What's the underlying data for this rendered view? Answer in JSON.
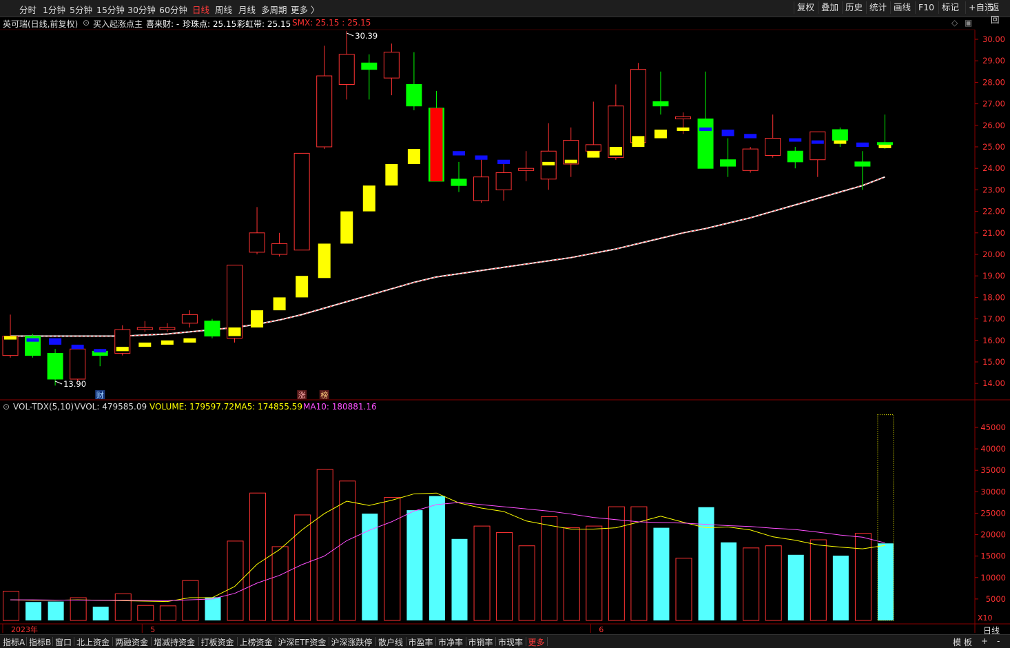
{
  "toolbar": {
    "periods": [
      "分时",
      "1分钟",
      "5分钟",
      "15分钟",
      "30分钟",
      "60分钟",
      "日线",
      "周线",
      "月线",
      "多周期",
      "更多 〉"
    ],
    "active_period": "日线",
    "right_buttons": [
      "复权",
      "叠加",
      "历史",
      "统计",
      "画线",
      "F10",
      "标记",
      "+自选",
      "返回"
    ]
  },
  "info": {
    "stock": "英可瑞(日线,前复权)",
    "indicator": "买入起涨点主",
    "xilaicai": "喜来财: -",
    "zhenzhu": "珍珠点: 25.15",
    "caihong": "彩虹带: 25.15",
    "smx": "SMX: 25.15 : 25.15"
  },
  "vol_info": {
    "name": "VOL-TDX(5,10)",
    "vvol": "VVOL: 479585.09",
    "volume": "VOLUME: 179597.72",
    "ma5": "MA5: 174855.59",
    "ma10": "MA10: 180881.16"
  },
  "bottom_tabs": [
    "指标A",
    "指标B",
    "窗口",
    "北上资金",
    "两融资金",
    "增减持资金",
    "打板资金",
    "上榜资金",
    "沪深ETF资金",
    "沪深涨跌停",
    "散户线",
    "市盈率",
    "市净率",
    "市销率",
    "市现率",
    "更多"
  ],
  "bottom_right": [
    "模 板",
    "+",
    "-"
  ],
  "period_label": "日线",
  "x10_label": "X10",
  "colors": {
    "up": "#ff3232",
    "down": "#54ffff",
    "ma5": "#ffff00",
    "ma10": "#ff50ff",
    "signal_yellow": "#ffff00",
    "signal_blue": "#1010ff",
    "signal_green": "#00ff00",
    "signal_red": "#ff0000"
  },
  "chart_data": [
    {
      "type": "candlestick",
      "ylim": [
        13.4,
        30.6
      ],
      "y_ticks": [
        14,
        15,
        16,
        17,
        18,
        19,
        20,
        21,
        22,
        23,
        24,
        25,
        26,
        27,
        28,
        29,
        30
      ],
      "x_labels": [
        {
          "index": 0,
          "text": "2023年"
        },
        {
          "index": 6,
          "text": "5"
        },
        {
          "index": 26,
          "text": "6"
        }
      ],
      "annotations": [
        {
          "text": "30.39",
          "index": 15,
          "kind": "high"
        },
        {
          "text": "13.90",
          "index": 2,
          "kind": "low"
        }
      ],
      "markers": [
        {
          "text": "财",
          "index": 4
        },
        {
          "text": "涨",
          "index": 13
        },
        {
          "text": "榜",
          "index": 14
        }
      ],
      "candles": [
        {
          "o": 15.3,
          "c": 16.2,
          "h": 17.2,
          "l": 15.2
        },
        {
          "o": 16.2,
          "c": 15.3,
          "h": 16.3,
          "l": 15.2
        },
        {
          "o": 15.4,
          "c": 14.2,
          "h": 15.6,
          "l": 13.9
        },
        {
          "o": 14.2,
          "c": 15.6,
          "h": 15.8,
          "l": 14.1
        },
        {
          "o": 15.5,
          "c": 15.3,
          "h": 15.6,
          "l": 14.8
        },
        {
          "o": 15.4,
          "c": 16.5,
          "h": 16.7,
          "l": 15.3
        },
        {
          "o": 16.5,
          "c": 16.6,
          "h": 16.9,
          "l": 16.4
        },
        {
          "o": 16.5,
          "c": 16.6,
          "h": 16.8,
          "l": 16.4
        },
        {
          "o": 16.8,
          "c": 17.2,
          "h": 17.4,
          "l": 16.6
        },
        {
          "o": 16.9,
          "c": 16.2,
          "h": 17.0,
          "l": 16.1
        },
        {
          "o": 16.1,
          "c": 19.5,
          "h": 19.5,
          "l": 15.9
        },
        {
          "o": 20.1,
          "c": 21.0,
          "h": 22.2,
          "l": 20.0
        },
        {
          "o": 20.0,
          "c": 20.5,
          "h": 21.0,
          "l": 19.9
        },
        {
          "o": 20.2,
          "c": 24.7,
          "h": 24.7,
          "l": 20.2
        },
        {
          "o": 25.0,
          "c": 28.3,
          "h": 29.7,
          "l": 24.9
        },
        {
          "o": 27.9,
          "c": 29.3,
          "h": 30.39,
          "l": 27.2
        },
        {
          "o": 28.9,
          "c": 28.6,
          "h": 29.3,
          "l": 27.2
        },
        {
          "o": 28.2,
          "c": 29.4,
          "h": 29.8,
          "l": 27.4
        },
        {
          "o": 27.9,
          "c": 26.9,
          "h": 29.4,
          "l": 26.7
        },
        {
          "o": 26.8,
          "c": 23.4,
          "h": 27.6,
          "l": 23.4
        },
        {
          "o": 23.5,
          "c": 23.2,
          "h": 24.3,
          "l": 22.9
        },
        {
          "o": 22.5,
          "c": 23.6,
          "h": 24.4,
          "l": 22.4
        },
        {
          "o": 23.0,
          "c": 23.8,
          "h": 24.3,
          "l": 22.5
        },
        {
          "o": 23.9,
          "c": 24.0,
          "h": 24.8,
          "l": 23.4
        },
        {
          "o": 23.5,
          "c": 24.8,
          "h": 26.1,
          "l": 23.0
        },
        {
          "o": 24.2,
          "c": 25.3,
          "h": 25.9,
          "l": 23.6
        },
        {
          "o": 24.8,
          "c": 25.1,
          "h": 27.1,
          "l": 24.5
        },
        {
          "o": 24.5,
          "c": 26.9,
          "h": 27.9,
          "l": 24.4
        },
        {
          "o": 25.2,
          "c": 28.6,
          "h": 28.9,
          "l": 25.0
        },
        {
          "o": 27.1,
          "c": 26.9,
          "h": 28.5,
          "l": 26.5
        },
        {
          "o": 26.3,
          "c": 26.4,
          "h": 26.6,
          "l": 25.6
        },
        {
          "o": 26.3,
          "c": 24.0,
          "h": 28.5,
          "l": 24.0
        },
        {
          "o": 24.4,
          "c": 24.1,
          "h": 25.4,
          "l": 23.6
        },
        {
          "o": 23.9,
          "c": 24.9,
          "h": 25.0,
          "l": 23.8
        },
        {
          "o": 24.6,
          "c": 25.4,
          "h": 26.5,
          "l": 24.5
        },
        {
          "o": 24.8,
          "c": 24.3,
          "h": 25.0,
          "l": 24.0
        },
        {
          "o": 24.4,
          "c": 25.7,
          "h": 25.7,
          "l": 23.6
        },
        {
          "o": 25.8,
          "c": 25.3,
          "h": 25.9,
          "l": 25.0
        },
        {
          "o": 24.3,
          "c": 24.1,
          "h": 24.8,
          "l": 23.0
        },
        {
          "o": 25.2,
          "c": 25.1,
          "h": 26.5,
          "l": 24.9
        }
      ],
      "signals": [
        {
          "index": 0,
          "color": "yellow",
          "top": 16.2,
          "bottom": 16.1
        },
        {
          "index": 1,
          "color": "blue",
          "top": 16.1,
          "bottom": 16.0
        },
        {
          "index": 2,
          "color": "blue",
          "top": 16.1,
          "bottom": 15.8
        },
        {
          "index": 3,
          "color": "blue",
          "top": 15.8,
          "bottom": 15.6
        },
        {
          "index": 4,
          "color": "blue",
          "top": 15.6,
          "bottom": 15.5
        },
        {
          "index": 5,
          "color": "yellow",
          "top": 15.7,
          "bottom": 15.5
        },
        {
          "index": 6,
          "color": "yellow",
          "top": 15.9,
          "bottom": 15.7
        },
        {
          "index": 7,
          "color": "yellow",
          "top": 16.0,
          "bottom": 15.8
        },
        {
          "index": 8,
          "color": "yellow",
          "top": 16.1,
          "bottom": 15.9
        },
        {
          "index": 9,
          "color": "green",
          "top": 16.9,
          "bottom": 16.2
        },
        {
          "index": 10,
          "color": "yellow",
          "top": 16.6,
          "bottom": 16.2
        },
        {
          "index": 11,
          "color": "yellow",
          "top": 17.4,
          "bottom": 16.6
        },
        {
          "index": 12,
          "color": "yellow",
          "top": 18.0,
          "bottom": 17.4
        },
        {
          "index": 13,
          "color": "yellow",
          "top": 19.0,
          "bottom": 18.0
        },
        {
          "index": 14,
          "color": "yellow",
          "top": 20.5,
          "bottom": 18.9
        },
        {
          "index": 15,
          "color": "yellow",
          "top": 22.0,
          "bottom": 20.5
        },
        {
          "index": 16,
          "color": "yellow",
          "top": 23.2,
          "bottom": 22.0
        },
        {
          "index": 17,
          "color": "yellow",
          "top": 24.2,
          "bottom": 23.2
        },
        {
          "index": 18,
          "color": "yellow",
          "top": 24.9,
          "bottom": 24.2
        },
        {
          "index": 19,
          "color": "red",
          "top": 26.8,
          "bottom": 23.4
        },
        {
          "index": 20,
          "color": "blue",
          "top": 24.8,
          "bottom": 24.6
        },
        {
          "index": 21,
          "color": "blue",
          "top": 24.6,
          "bottom": 24.4
        },
        {
          "index": 22,
          "color": "blue",
          "top": 24.4,
          "bottom": 24.2
        },
        {
          "index": 24,
          "color": "yellow",
          "top": 24.3,
          "bottom": 24.2
        },
        {
          "index": 25,
          "color": "yellow",
          "top": 24.4,
          "bottom": 24.3
        },
        {
          "index": 26,
          "color": "yellow",
          "top": 24.8,
          "bottom": 24.5
        },
        {
          "index": 27,
          "color": "yellow",
          "top": 25.0,
          "bottom": 24.6
        },
        {
          "index": 28,
          "color": "yellow",
          "top": 25.5,
          "bottom": 25.0
        },
        {
          "index": 29,
          "color": "yellow",
          "top": 25.8,
          "bottom": 25.4
        },
        {
          "index": 30,
          "color": "yellow",
          "top": 25.9,
          "bottom": 25.8
        },
        {
          "index": 31,
          "color": "blue",
          "top": 25.9,
          "bottom": 25.8
        },
        {
          "index": 32,
          "color": "blue",
          "top": 25.8,
          "bottom": 25.5
        },
        {
          "index": 33,
          "color": "blue",
          "top": 25.6,
          "bottom": 25.4
        },
        {
          "index": 35,
          "color": "blue",
          "top": 25.4,
          "bottom": 25.3
        },
        {
          "index": 36,
          "color": "blue",
          "top": 25.3,
          "bottom": 25.2
        },
        {
          "index": 37,
          "color": "yellow",
          "top": 25.3,
          "bottom": 25.2
        },
        {
          "index": 38,
          "color": "blue",
          "top": 25.2,
          "bottom": 25.0
        },
        {
          "index": 39,
          "color": "yellow",
          "top": 25.1,
          "bottom": 25.0
        }
      ],
      "ma_line": [
        16.2,
        16.2,
        16.2,
        16.2,
        16.2,
        16.2,
        16.25,
        16.3,
        16.4,
        16.5,
        16.6,
        16.75,
        16.95,
        17.2,
        17.5,
        17.8,
        18.1,
        18.4,
        18.7,
        18.95,
        19.1,
        19.25,
        19.4,
        19.55,
        19.7,
        19.85,
        20.05,
        20.25,
        20.5,
        20.75,
        21.0,
        21.2,
        21.45,
        21.7,
        22.0,
        22.3,
        22.6,
        22.9,
        23.2,
        23.6
      ],
      "ma_line_start": 0
    },
    {
      "type": "bar",
      "title": "VOL-TDX(5,10)",
      "ylim": [
        0,
        50000
      ],
      "y_ticks": [
        5000,
        10000,
        15000,
        20000,
        25000,
        30000,
        35000,
        40000,
        45000
      ],
      "unit_label": "X10",
      "volumes": [
        6800,
        4300,
        4400,
        5300,
        3200,
        6200,
        3500,
        3400,
        9300,
        5400,
        18500,
        29700,
        17200,
        24600,
        35200,
        32500,
        24900,
        28700,
        25700,
        29000,
        19000,
        22000,
        20500,
        17400,
        24200,
        21600,
        22000,
        26500,
        26500,
        21600,
        14500,
        26400,
        18200,
        16900,
        17400,
        15300,
        18800,
        15100,
        20300,
        17960
      ],
      "up": [
        true,
        false,
        false,
        true,
        false,
        true,
        true,
        true,
        true,
        false,
        true,
        true,
        true,
        true,
        true,
        true,
        false,
        true,
        false,
        false,
        false,
        true,
        true,
        true,
        true,
        true,
        true,
        true,
        true,
        false,
        true,
        false,
        false,
        true,
        true,
        false,
        true,
        false,
        true,
        false
      ],
      "ma5": [
        4800,
        4700,
        4700,
        4800,
        4700,
        4600,
        4500,
        4400,
        5300,
        5300,
        7900,
        13100,
        16500,
        21100,
        24900,
        27800,
        26800,
        28000,
        29500,
        29700,
        27400,
        26200,
        25400,
        23200,
        22200,
        21300,
        21300,
        21600,
        22900,
        24300,
        22900,
        21600,
        21800,
        21100,
        19500,
        18700,
        17600,
        17100,
        16700,
        17486
      ],
      "ma10": [
        4800,
        4800,
        4750,
        4750,
        4700,
        4700,
        4650,
        4600,
        4800,
        5000,
        6300,
        8700,
        10500,
        13000,
        15000,
        18600,
        21000,
        23000,
        25500,
        27000,
        27500,
        27000,
        26500,
        26000,
        25500,
        24800,
        24000,
        23500,
        23000,
        22800,
        22700,
        22400,
        22100,
        21900,
        21500,
        21200,
        20600,
        19900,
        19400,
        18088
      ],
      "vvol_bar": 47958,
      "vvol_index": 39
    }
  ]
}
